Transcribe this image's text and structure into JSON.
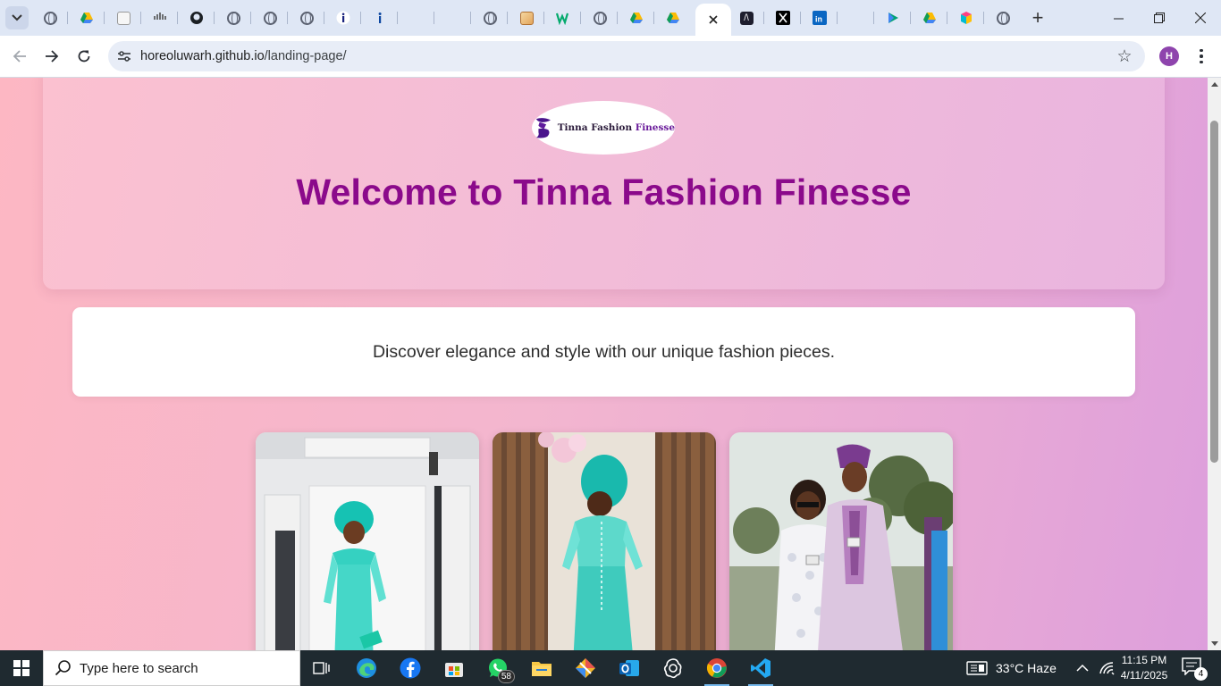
{
  "browser": {
    "url_host": "horeoluwarh.github.io",
    "url_path": "/landing-page/",
    "profile_initial": "H",
    "tabs": [
      {
        "icon": "globe-icon"
      },
      {
        "icon": "google-drive-icon"
      },
      {
        "icon": "app-icon"
      },
      {
        "icon": "cisco-icon"
      },
      {
        "icon": "github-icon"
      },
      {
        "icon": "globe-icon"
      },
      {
        "icon": "globe-icon"
      },
      {
        "icon": "globe-icon"
      },
      {
        "icon": "info-icon"
      },
      {
        "icon": "info-icon"
      },
      {
        "icon": "blank-icon"
      },
      {
        "icon": "blank-icon"
      },
      {
        "icon": "globe-icon"
      },
      {
        "icon": "image-icon"
      },
      {
        "icon": "w3-icon"
      },
      {
        "icon": "globe-icon"
      },
      {
        "icon": "google-drive-icon"
      },
      {
        "icon": "google-drive-icon"
      },
      {
        "icon": "close-icon",
        "active": true
      },
      {
        "icon": "app-icon"
      },
      {
        "icon": "x-icon"
      },
      {
        "icon": "linkedin-icon"
      },
      {
        "icon": "blank-icon"
      },
      {
        "icon": "play-icon"
      },
      {
        "icon": "google-drive-icon"
      },
      {
        "icon": "app-icon"
      },
      {
        "icon": "globe-icon"
      }
    ]
  },
  "page": {
    "logo_text": "Tinna Fashion",
    "logo_text_accent": "Finesse",
    "hero_title": "Welcome to Tinna Fashion Finesse",
    "tagline": "Discover elegance and style with our unique fashion pieces."
  },
  "taskbar": {
    "search_placeholder": "Type here to search",
    "whatsapp_badge": "58",
    "weather": "33°C  Haze",
    "time": "11:15 PM",
    "date": "4/11/2025",
    "notifications": "4"
  },
  "colors": {
    "accent": "#8b0a8b",
    "brand_purple": "#6a1b9a"
  }
}
